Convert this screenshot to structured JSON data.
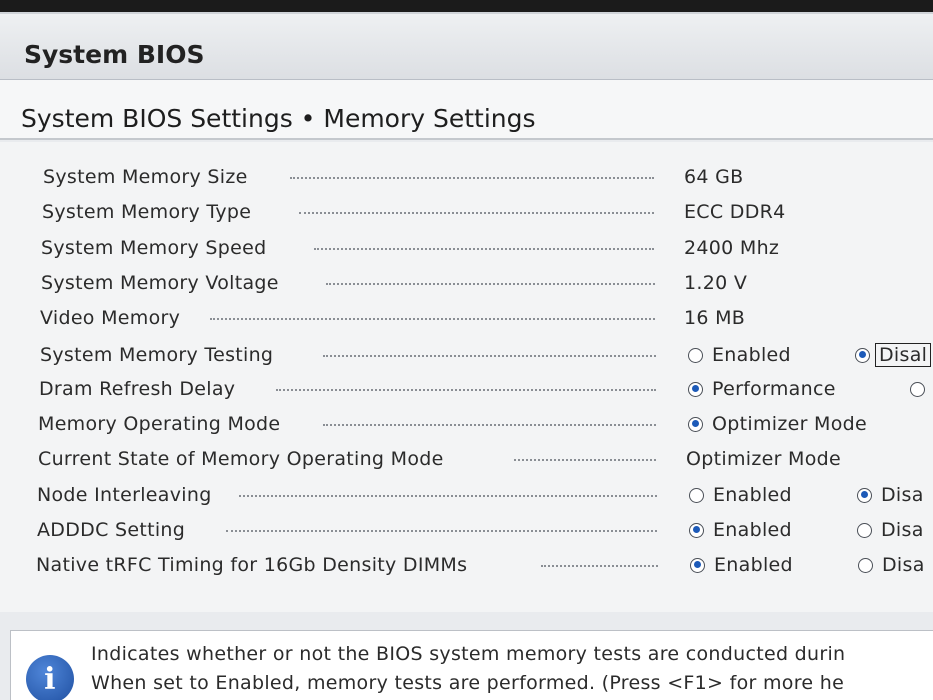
{
  "window": {
    "title": "System BIOS"
  },
  "page": {
    "subtitle": "System BIOS Settings • Memory Settings"
  },
  "settings": [
    {
      "label": "System Memory Size",
      "value": "64 GB"
    },
    {
      "label": "System Memory Type",
      "value": "ECC DDR4"
    },
    {
      "label": "System Memory Speed",
      "value": "2400 Mhz"
    },
    {
      "label": "System Memory Voltage",
      "value": "1.20 V"
    },
    {
      "label": "Video Memory",
      "value": "16 MB"
    },
    {
      "label": "System Memory Testing",
      "options": [
        "Enabled",
        "Disal"
      ],
      "selected": 1
    },
    {
      "label": "Dram Refresh Delay",
      "options": [
        "Performance",
        ""
      ],
      "selected": 0
    },
    {
      "label": "Memory Operating Mode",
      "options": [
        "Optimizer Mode"
      ],
      "selected": 0
    },
    {
      "label": "Current State of Memory Operating Mode",
      "value": "Optimizer Mode"
    },
    {
      "label": "Node Interleaving",
      "options": [
        "Enabled",
        "Disa"
      ],
      "selected": 1
    },
    {
      "label": "ADDDC Setting",
      "options": [
        "Enabled",
        "Disa"
      ],
      "selected": 0
    },
    {
      "label": "Native tRFC Timing for 16Gb Density DIMMs",
      "options": [
        "Enabled",
        "Disa"
      ],
      "selected": 0
    }
  ],
  "help": {
    "line1": "Indicates whether or not the BIOS system memory tests are conducted durin",
    "line2": "When set to Enabled, memory tests are performed. (Press <F1> for more he",
    "icon": "info-icon"
  },
  "colors": {
    "radio_selected": "#1d5ab8",
    "info_icon": "#1f4fa0"
  }
}
